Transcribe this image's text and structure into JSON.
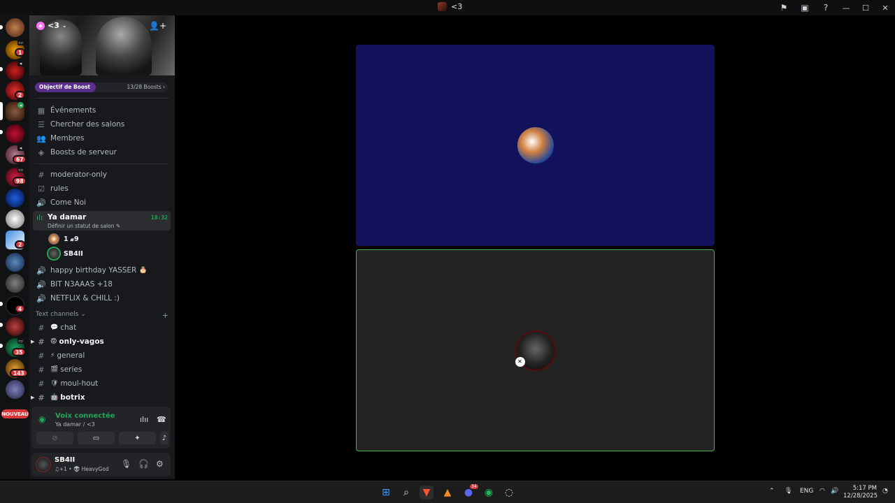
{
  "window": {
    "title": "<3"
  },
  "server": {
    "name": "<3",
    "boost_goal_label": "Objectif de Boost",
    "boost_count": "13/28 Boosts",
    "boost_progress": 0.46
  },
  "menu": [
    {
      "label": "Événements",
      "icon": "calendar-icon"
    },
    {
      "label": "Chercher des salons",
      "icon": "browse-channels-icon"
    },
    {
      "label": "Membres",
      "icon": "members-icon"
    },
    {
      "label": "Boosts de serveur",
      "icon": "boost-icon"
    }
  ],
  "channels_top": [
    {
      "label": "moderator-only",
      "icon": "#"
    },
    {
      "label": "rules",
      "icon": "☑"
    },
    {
      "label": "Come Noi",
      "icon": "🔊"
    }
  ],
  "active_voice": {
    "name": "Ya damar",
    "status_hint": "Définir un statut de salon",
    "timer": "18:32",
    "users": [
      {
        "name": "1 𝔁9"
      },
      {
        "name": "SB4II"
      }
    ]
  },
  "voice_channels": [
    {
      "label": "happy birthday YASSER",
      "emoji": "🎂"
    },
    {
      "label": "BIT N3AAAS +18",
      "emoji": ""
    },
    {
      "label": "NETFLIX & CHILL :)",
      "emoji": ""
    }
  ],
  "text_category": "Text channels",
  "text_channels": [
    {
      "label": "chat",
      "emoji": "💬",
      "bold": false,
      "arrow": false
    },
    {
      "label": "only-vagos",
      "emoji": "😡",
      "bold": true,
      "arrow": true
    },
    {
      "label": "general",
      "emoji": "⚡",
      "bold": false,
      "arrow": false
    },
    {
      "label": "series",
      "emoji": "🎬",
      "bold": false,
      "arrow": false
    },
    {
      "label": "moul-hout",
      "emoji": "🛡",
      "bold": false,
      "arrow": false
    },
    {
      "label": "botrix",
      "emoji": "🤖",
      "bold": true,
      "arrow": true
    }
  ],
  "voice_panel": {
    "title": "Voix connectée",
    "subtitle": "Ya damar / <3"
  },
  "user_panel": {
    "name": "SB4II",
    "status": "♫+1 • 👽 HeavyGod"
  },
  "rail_badges": [
    "1",
    "2",
    "67",
    "98",
    "2",
    "4",
    "35",
    "143"
  ],
  "rail_new_label": "NOUVEAU",
  "taskbar": {
    "lang": "ENG",
    "time": "5:17 PM",
    "date": "12/28/2025",
    "discord_badge": "34"
  },
  "colors": {
    "accent_green": "#23a55a",
    "speaking_border": "#3fb950",
    "tile_bg": "#12125c",
    "badge_red": "#da373c"
  }
}
